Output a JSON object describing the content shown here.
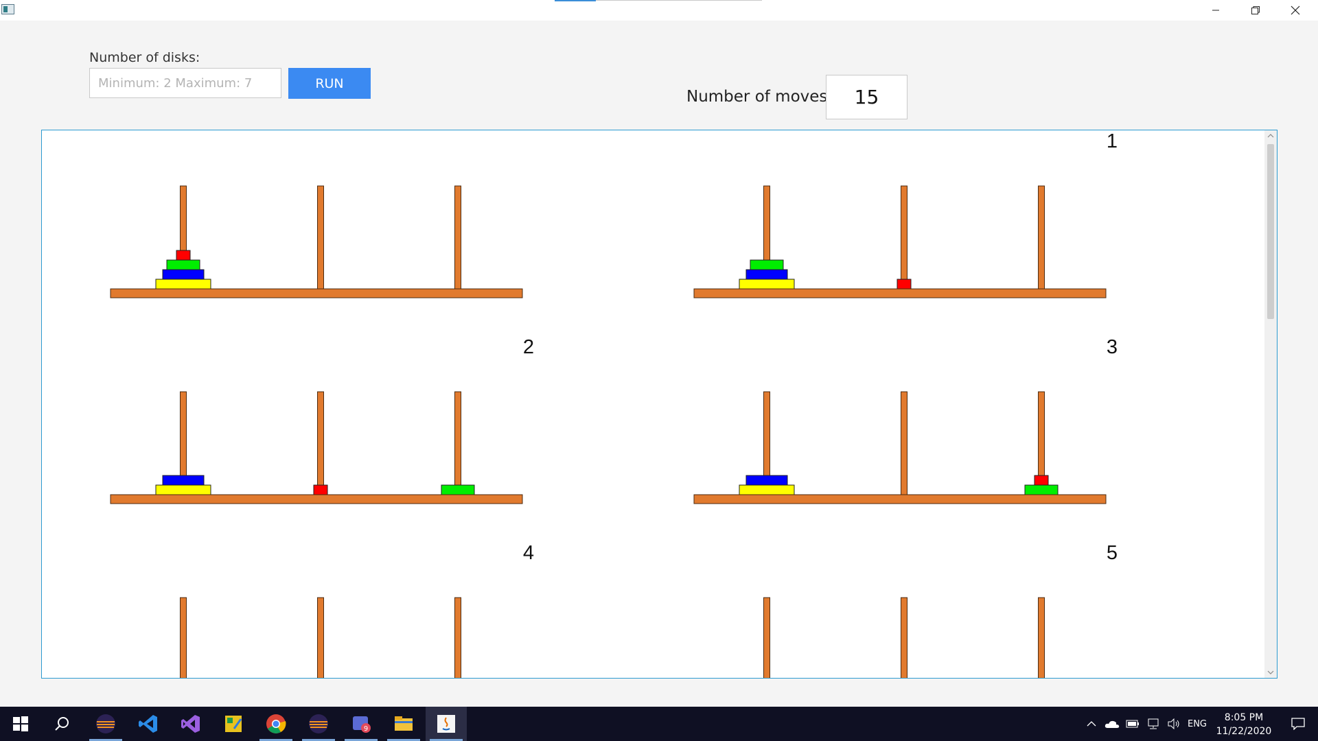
{
  "window": {
    "minimize_icon": "minimize-icon",
    "restore_icon": "restore-icon",
    "close_icon": "close-icon"
  },
  "controls": {
    "disks_label": "Number of disks:",
    "disks_placeholder": "Minimum: 2 Maximum: 7",
    "disks_value": "",
    "run_label": "RUN",
    "moves_label": "Number of moves:",
    "moves_value": "15"
  },
  "colors": {
    "wood": "#e17a2e",
    "wood_stroke": "#4a2a10",
    "disk_red": "#ff0000",
    "disk_green": "#00ee00",
    "disk_blue": "#0000ff",
    "disk_yellow": "#ffff00",
    "accent": "#3b8af2"
  },
  "puzzle": {
    "disk_count": 4,
    "disk_colors_small_to_large": [
      "red",
      "green",
      "blue",
      "yellow"
    ],
    "states": [
      {
        "label": "",
        "pegs": [
          [
            4,
            3,
            2,
            1
          ],
          [],
          []
        ]
      },
      {
        "label": "1",
        "pegs": [
          [
            4,
            3,
            2
          ],
          [
            1
          ],
          []
        ]
      },
      {
        "label": "2",
        "pegs": [
          [
            4,
            3
          ],
          [
            1
          ],
          [
            2
          ]
        ]
      },
      {
        "label": "3",
        "pegs": [
          [
            4,
            3
          ],
          [],
          [
            2,
            1
          ]
        ]
      },
      {
        "label": "4",
        "pegs": [
          [],
          [],
          []
        ]
      },
      {
        "label": "5",
        "pegs": [
          [],
          [],
          []
        ]
      }
    ]
  },
  "taskbar": {
    "items": [
      {
        "name": "start-button-icon",
        "open": false,
        "active": false
      },
      {
        "name": "search-icon",
        "open": false,
        "active": false
      },
      {
        "name": "eclipse-icon",
        "open": true,
        "active": false
      },
      {
        "name": "vscode-icon",
        "open": true,
        "active": false
      },
      {
        "name": "visual-studio-icon",
        "open": false,
        "active": false
      },
      {
        "name": "app-icon",
        "open": false,
        "active": false
      },
      {
        "name": "chrome-icon",
        "open": true,
        "active": false
      },
      {
        "name": "eclipse-icon",
        "open": true,
        "active": false
      },
      {
        "name": "teams-icon",
        "open": true,
        "active": false
      },
      {
        "name": "file-explorer-icon",
        "open": true,
        "active": false
      },
      {
        "name": "java-icon",
        "open": true,
        "active": true
      }
    ],
    "tray": {
      "language": "ENG",
      "time": "8:05 PM",
      "date": "11/22/2020"
    }
  }
}
